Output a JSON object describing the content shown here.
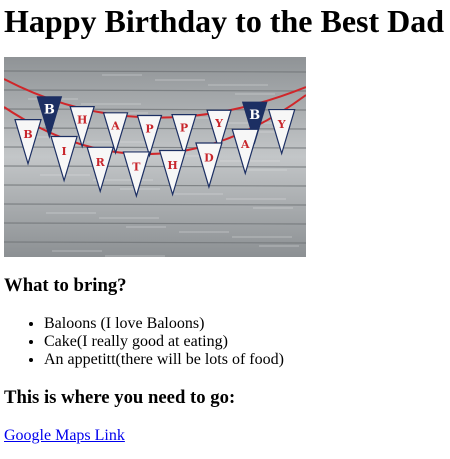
{
  "page": {
    "title": "Happy Birthday to the Best Dad"
  },
  "banner_image": {
    "row1_letters": [
      "H",
      "A",
      "P",
      "P",
      "Y"
    ],
    "row2_letters": [
      "B",
      "I",
      "R",
      "T",
      "H",
      "D",
      "A",
      "Y"
    ],
    "end_logo_letter": "B",
    "colors": {
      "wood": "#b9bcbf",
      "flag_white": "#f7f7f7",
      "letter_red": "#c8262c",
      "navy": "#1c2f63",
      "string_red": "#d0262a"
    }
  },
  "bring_section": {
    "heading": "What to bring?",
    "items": [
      "Baloons (I love Baloons)",
      "Cake(I really good at eating)",
      "An appetitt(there will be lots of food)"
    ]
  },
  "location_section": {
    "heading": "This is where you need to go:",
    "link_text": "Google Maps Link"
  }
}
